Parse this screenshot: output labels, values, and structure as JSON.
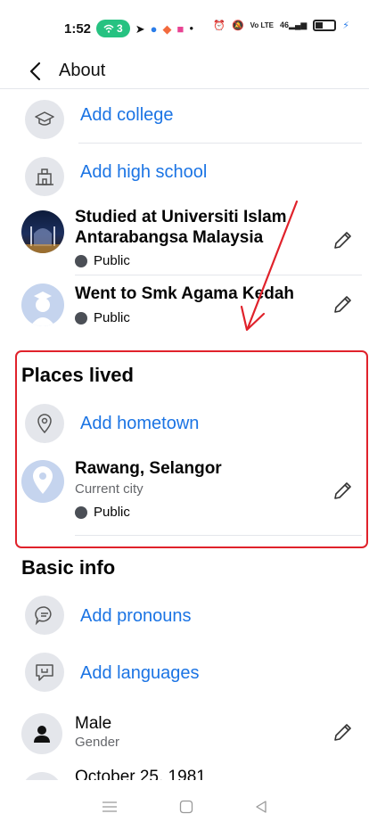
{
  "status_bar": {
    "time": "1:52",
    "hotspot_count": "3",
    "right_text": "46"
  },
  "header": {
    "title": "About",
    "back_icon": "back-arrow-icon"
  },
  "education": {
    "add_college": "Add college",
    "add_high_school": "Add high school",
    "items": [
      {
        "title": "Studied at Universiti Islam Antarabangsa Malaysia",
        "privacy": "Public"
      },
      {
        "title": "Went to Smk Agama Kedah",
        "privacy": "Public"
      }
    ]
  },
  "places_lived": {
    "title": "Places lived",
    "add_hometown": "Add hometown",
    "current_city": {
      "title": "Rawang, Selangor",
      "subtitle": "Current city",
      "privacy": "Public"
    }
  },
  "basic_info": {
    "title": "Basic info",
    "add_pronouns": "Add pronouns",
    "add_languages": "Add languages",
    "gender": {
      "value": "Male",
      "label": "Gender"
    },
    "birthday": {
      "value": "October 25, 1981"
    }
  },
  "colors": {
    "link": "#1b74e4",
    "annotation_red": "#e0222b"
  }
}
